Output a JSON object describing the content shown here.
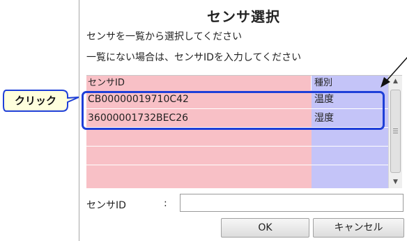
{
  "dialog": {
    "title": "センサ選択",
    "instruction_1": "センサを一覧から選択してください",
    "instruction_2": "一覧にない場合は、センサIDを入力してください"
  },
  "table": {
    "headers": [
      "センサID",
      "種別"
    ],
    "rows": [
      {
        "sensor_id": "CB00000019710C42",
        "type": "温度"
      },
      {
        "sensor_id": "36000001732BEC26",
        "type": "湿度"
      },
      {
        "sensor_id": "",
        "type": ""
      },
      {
        "sensor_id": "",
        "type": ""
      },
      {
        "sensor_id": "",
        "type": ""
      }
    ]
  },
  "colors": {
    "id_column": "#f8c0c6",
    "type_column": "#c4c4f8",
    "selection_frame": "#1e3fd8"
  },
  "input": {
    "label": "センサID",
    "colon": ":",
    "value": ""
  },
  "buttons": {
    "ok": "OK",
    "cancel": "キャンセル"
  },
  "annotation": {
    "callout_text": "クリック"
  },
  "icons": {
    "scroll_up": "scroll-up-arrow-icon",
    "scroll_down": "scroll-down-arrow-icon",
    "scroll_grip": "scroll-grip-icon",
    "pointer_arrow": "annotation-arrow-icon"
  }
}
